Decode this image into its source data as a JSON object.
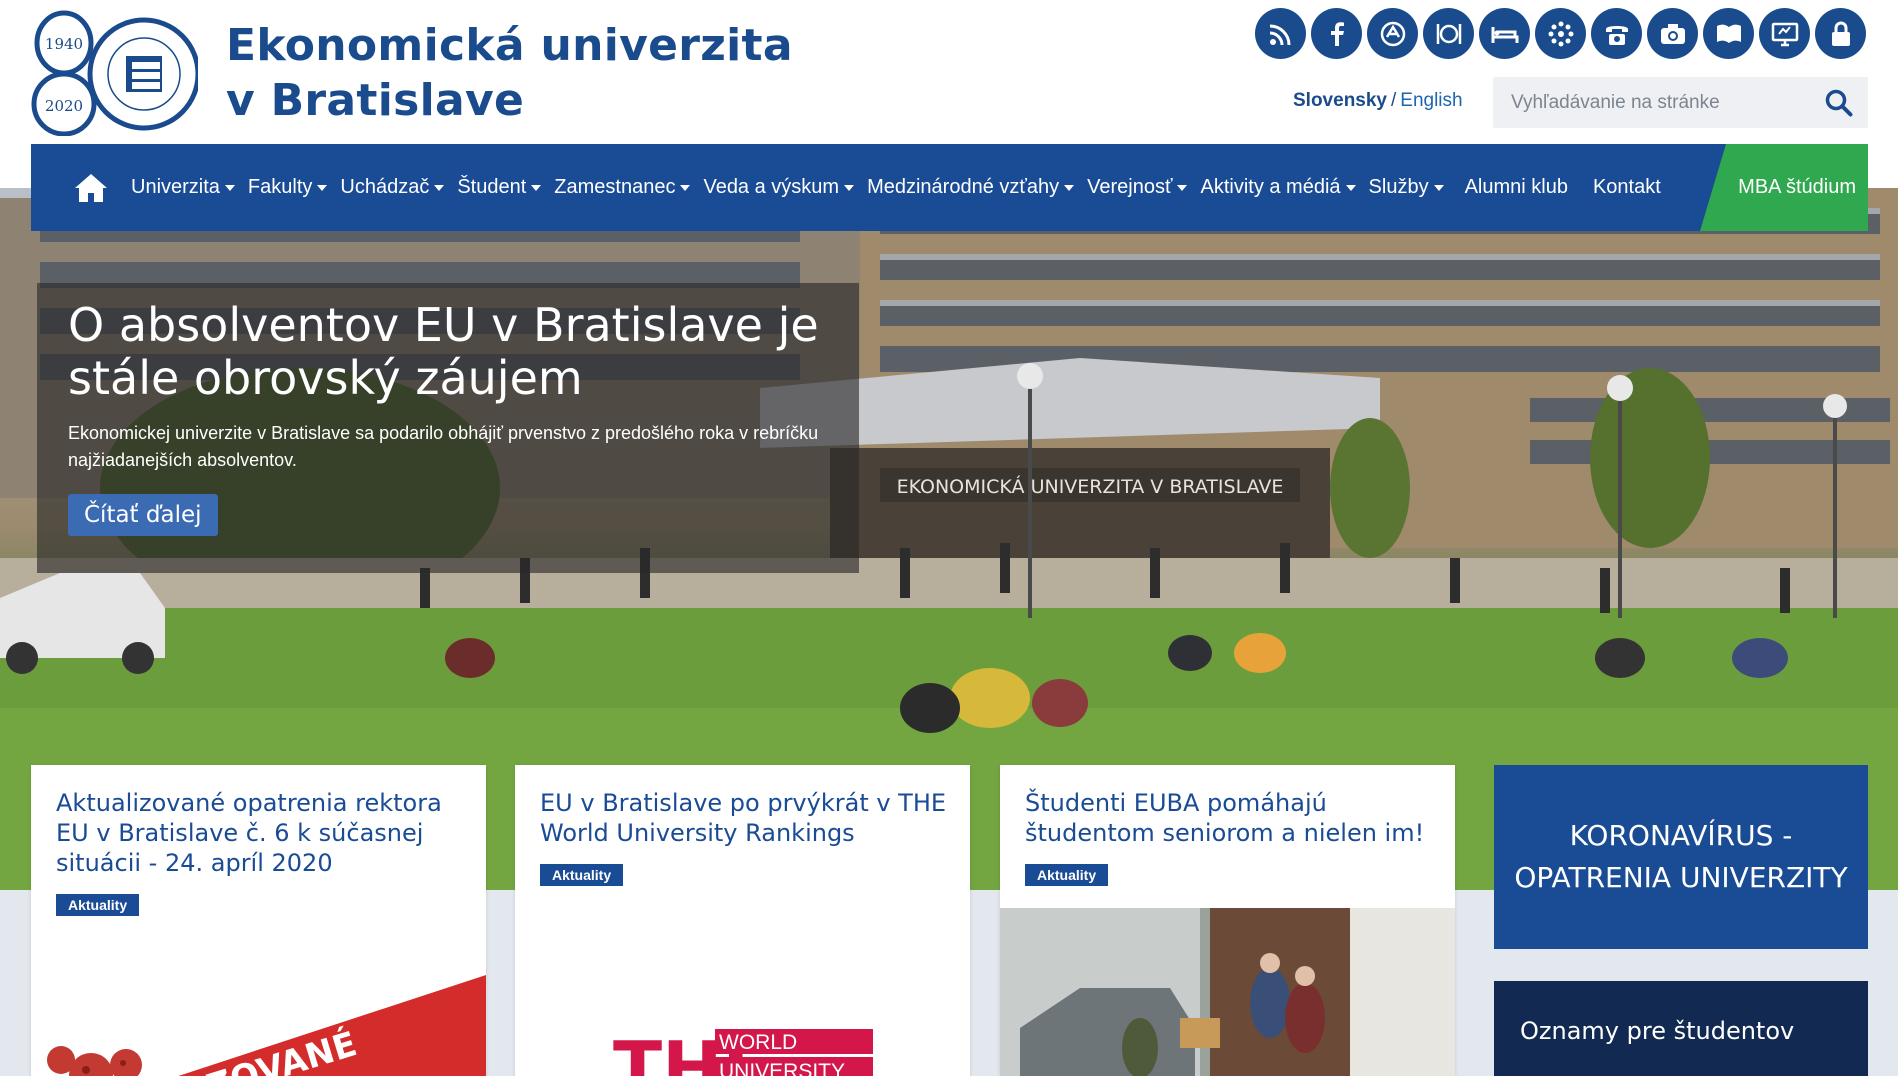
{
  "header": {
    "logo": {
      "year_start": "1940",
      "year_end": "2020",
      "seal_text": "EKONOMICKÁ UNIVERZITA V BRATISLAVE"
    },
    "site_name_line1": "Ekonomická univerzita",
    "site_name_line2": "v Bratislave",
    "icons": [
      "rss-icon",
      "facebook-icon",
      "ais-icon",
      "canteen-icon",
      "dormitory-icon",
      "network-icon",
      "phone-icon",
      "camera-icon",
      "library-icon",
      "elearning-icon",
      "lock-icon"
    ],
    "lang_active": "Slovensky",
    "lang_separator": "/",
    "lang_other": "English",
    "search_placeholder": "Vyhľadávanie na stránke"
  },
  "nav": {
    "items": [
      {
        "label": "Univerzita",
        "dropdown": true
      },
      {
        "label": "Fakulty",
        "dropdown": true
      },
      {
        "label": "Uchádzač",
        "dropdown": true
      },
      {
        "label": "Študent",
        "dropdown": true
      },
      {
        "label": "Zamestnanec",
        "dropdown": true
      },
      {
        "label": "Veda a výskum",
        "dropdown": true
      },
      {
        "label": "Medzinárodné vzťahy",
        "dropdown": true
      },
      {
        "label": "Verejnosť",
        "dropdown": true
      },
      {
        "label": "Aktivity a médiá",
        "dropdown": true
      },
      {
        "label": "Služby",
        "dropdown": true
      },
      {
        "label": "Alumni klub",
        "dropdown": false
      },
      {
        "label": "Kontakt",
        "dropdown": false
      }
    ],
    "mba_label": "MBA štúdium"
  },
  "hero": {
    "title": "O absolventov EU v Bratislave je stále obrovský záujem",
    "text": "Ekonomickej univerzite v Bratislave sa podarilo obhájiť prvenstvo z predošlého roka v rebríčku najžiadanejších absolventov.",
    "button": "Čítať ďalej",
    "building_sign": "EKONOMICKÁ UNIVERZITA V BRATISLAVE"
  },
  "news": [
    {
      "title": "Aktualizované opatrenia rektora EU v Bratislave č. 6 k súčasnej situácii - 24. apríl 2020",
      "badge": "Aktuality",
      "image_text": "IZOVANÉ"
    },
    {
      "title": "EU v Bratislave po prvýkrát v THE World University Rankings",
      "badge": "Aktuality",
      "image_text_the": "THE",
      "image_text_world": "WORLD",
      "image_text_university": "UNIVERSITY"
    },
    {
      "title": "Študenti EUBA pomáhajú študentom seniorom a nielen im!",
      "badge": "Aktuality"
    }
  ],
  "side": {
    "corona": "KORONAVÍRUS - OPATRENIA UNIVERZITY",
    "notices": "Oznamy pre študentov"
  },
  "colors": {
    "brand_blue": "#1a4b95",
    "mba_green": "#2fa84f"
  }
}
